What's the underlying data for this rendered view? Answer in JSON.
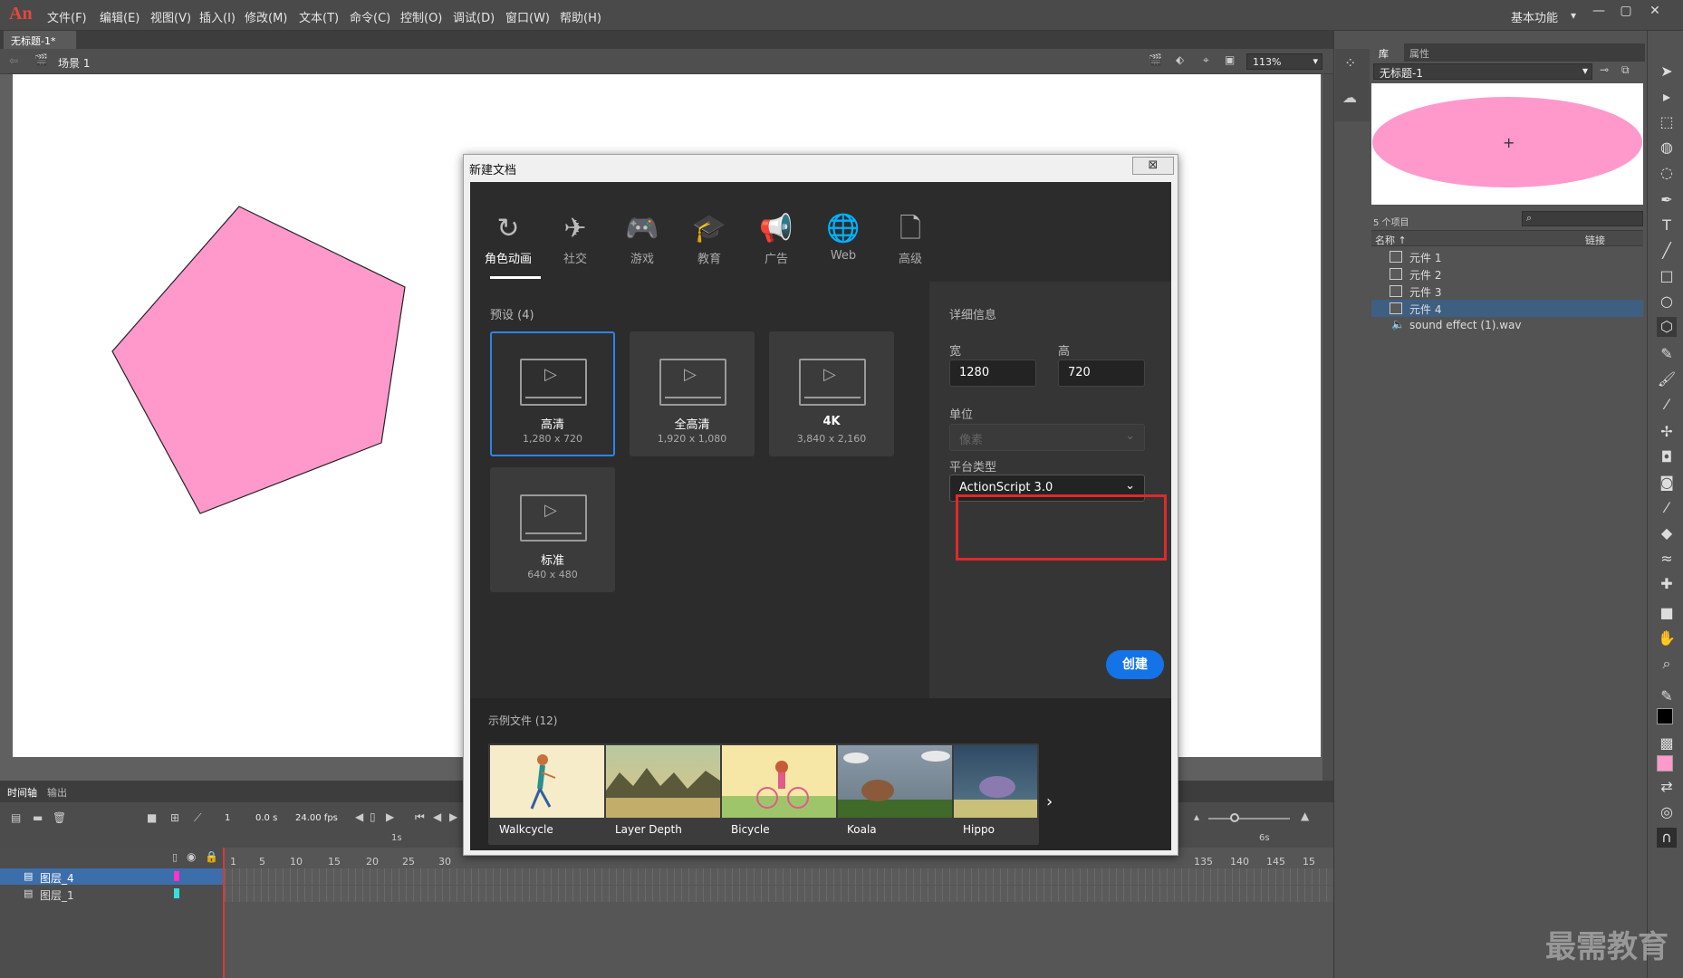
{
  "app": {
    "logo": "An"
  },
  "menu": [
    "文件(F)",
    "编辑(E)",
    "视图(V)",
    "插入(I)",
    "修改(M)",
    "文本(T)",
    "命令(C)",
    "控制(O)",
    "调试(D)",
    "窗口(W)",
    "帮助(H)"
  ],
  "workspace": "基本功能",
  "document_tab": "无标题-1*",
  "breadcrumb": {
    "scene": "场景 1"
  },
  "zoom": "113%",
  "dialog": {
    "title": "新建文档",
    "close": "⊠",
    "categories": [
      {
        "label": "角色动画",
        "icon": "character-animation-icon"
      },
      {
        "label": "社交",
        "icon": "paper-plane-icon"
      },
      {
        "label": "游戏",
        "icon": "gamepad-icon"
      },
      {
        "label": "教育",
        "icon": "graduation-cap-icon"
      },
      {
        "label": "广告",
        "icon": "megaphone-icon"
      },
      {
        "label": "Web",
        "icon": "globe-icon"
      },
      {
        "label": "高级",
        "icon": "document-icon"
      }
    ],
    "presets_title": "预设 (4)",
    "presets": [
      {
        "name": "高清",
        "dims": "1,280 x 720"
      },
      {
        "name": "全高清",
        "dims": "1,920 x 1,080"
      },
      {
        "name": "4K",
        "dims": "3,840 x 2,160"
      },
      {
        "name": "标准",
        "dims": "640 x 480"
      }
    ],
    "details": {
      "title": "详细信息",
      "width_label": "宽",
      "height_label": "高",
      "width": "1280",
      "height": "720",
      "unit_label": "单位",
      "unit_value": "像素",
      "platform_label": "平台类型",
      "platform_value": "ActionScript 3.0"
    },
    "create": "创建",
    "samples_title": "示例文件 (12)",
    "samples": [
      "Walkcycle",
      "Layer Depth",
      "Bicycle",
      "Koala",
      "Hippo"
    ]
  },
  "timeline": {
    "tabs": [
      "时间轴",
      "输出"
    ],
    "frame": "1",
    "time": "0.0 s",
    "fps": "24.00 fps",
    "ruler_seconds": [
      "1s",
      "6s"
    ],
    "ruler": [
      "1",
      "5",
      "10",
      "15",
      "20",
      "25",
      "30",
      "135",
      "140",
      "145",
      "15"
    ],
    "layers": [
      "图层_4",
      "图层_1"
    ]
  },
  "library": {
    "tabs": [
      "库",
      "属性"
    ],
    "document": "无标题-1",
    "count": "5 个项目",
    "col_name": "名称 ↑",
    "col_link": "链接",
    "items": [
      "元件 1",
      "元件 2",
      "元件 3",
      "元件 4",
      "sound effect (1).wav"
    ]
  },
  "watermark": "最需教育",
  "colors": {
    "pink": "#ff99cc",
    "accent": "#1473e6",
    "highlight": "#e02929"
  }
}
